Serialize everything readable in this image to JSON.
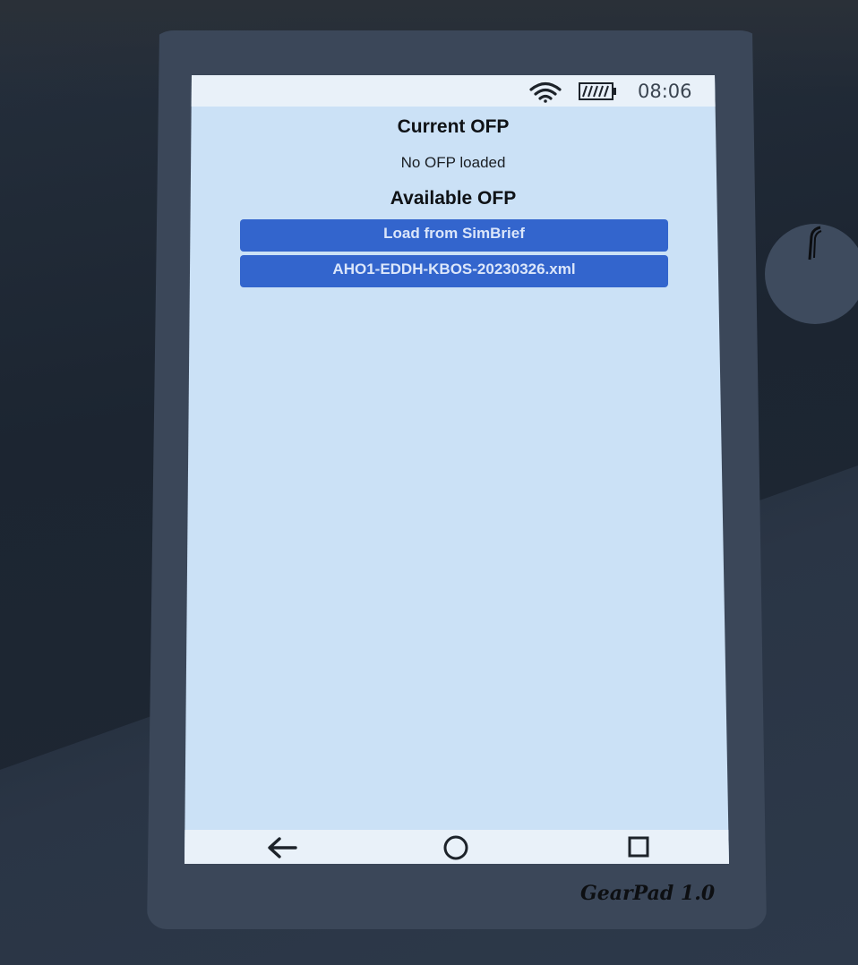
{
  "status_bar": {
    "time": "08:06",
    "wifi_icon": "wifi-icon",
    "battery_icon": "battery-icon"
  },
  "current_ofp": {
    "heading": "Current OFP",
    "status": "No OFP loaded"
  },
  "available_ofp": {
    "heading": "Available OFP",
    "buttons": [
      {
        "label": "Load from SimBrief"
      },
      {
        "label": "AHO1-EDDH-KBOS-20230326.xml"
      }
    ]
  },
  "nav_bar": {
    "back_icon": "arrow-left-icon",
    "home_icon": "circle-home-icon",
    "recent_icon": "square-recent-icon"
  },
  "device": {
    "brand": "GearPad 1.0"
  },
  "colors": {
    "screen_bg": "#cbe1f6",
    "button_bg": "#3365cd",
    "bezel": "#3b4759"
  }
}
